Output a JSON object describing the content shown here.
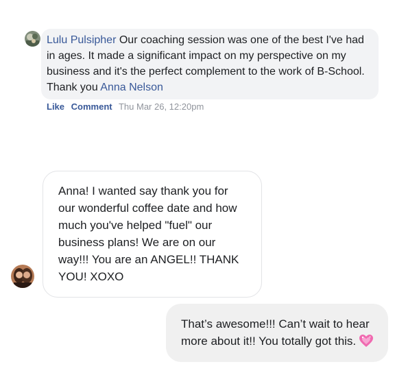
{
  "comment": {
    "author": "Lulu Pulsipher",
    "text": " Our coaching session was one of the best I've had in ages. It made a significant impact on my perspective on my business and it's the perfect complement to the work of B-School. Thank you ",
    "mention": "Anna Nelson",
    "actions": {
      "like": "Like",
      "reply": "Comment"
    },
    "timestamp": "Thu Mar 26, 12:20pm",
    "avatar_icon": "user-avatar-photo"
  },
  "messages": {
    "incoming": {
      "text": "Anna! I wanted say thank you for our wonderful coffee date and how much you've helped \"fuel\" our business plans! We are on our way!!! You are an ANGEL!! THANK YOU! XOXO",
      "avatar_icon": "user-avatar-photo"
    },
    "outgoing": {
      "text": "That’s awesome!!! Can’t wait to hear more about it!! You totally got this.",
      "emoji_icon": "sparkling-heart-icon"
    }
  },
  "colors": {
    "link": "#385898",
    "timestamp": "#90949c",
    "comment_bubble": "#f2f3f5",
    "outgoing_bubble": "#f0f0f0",
    "incoming_border": "#e2e3e6",
    "heart": "#f06ab0"
  }
}
